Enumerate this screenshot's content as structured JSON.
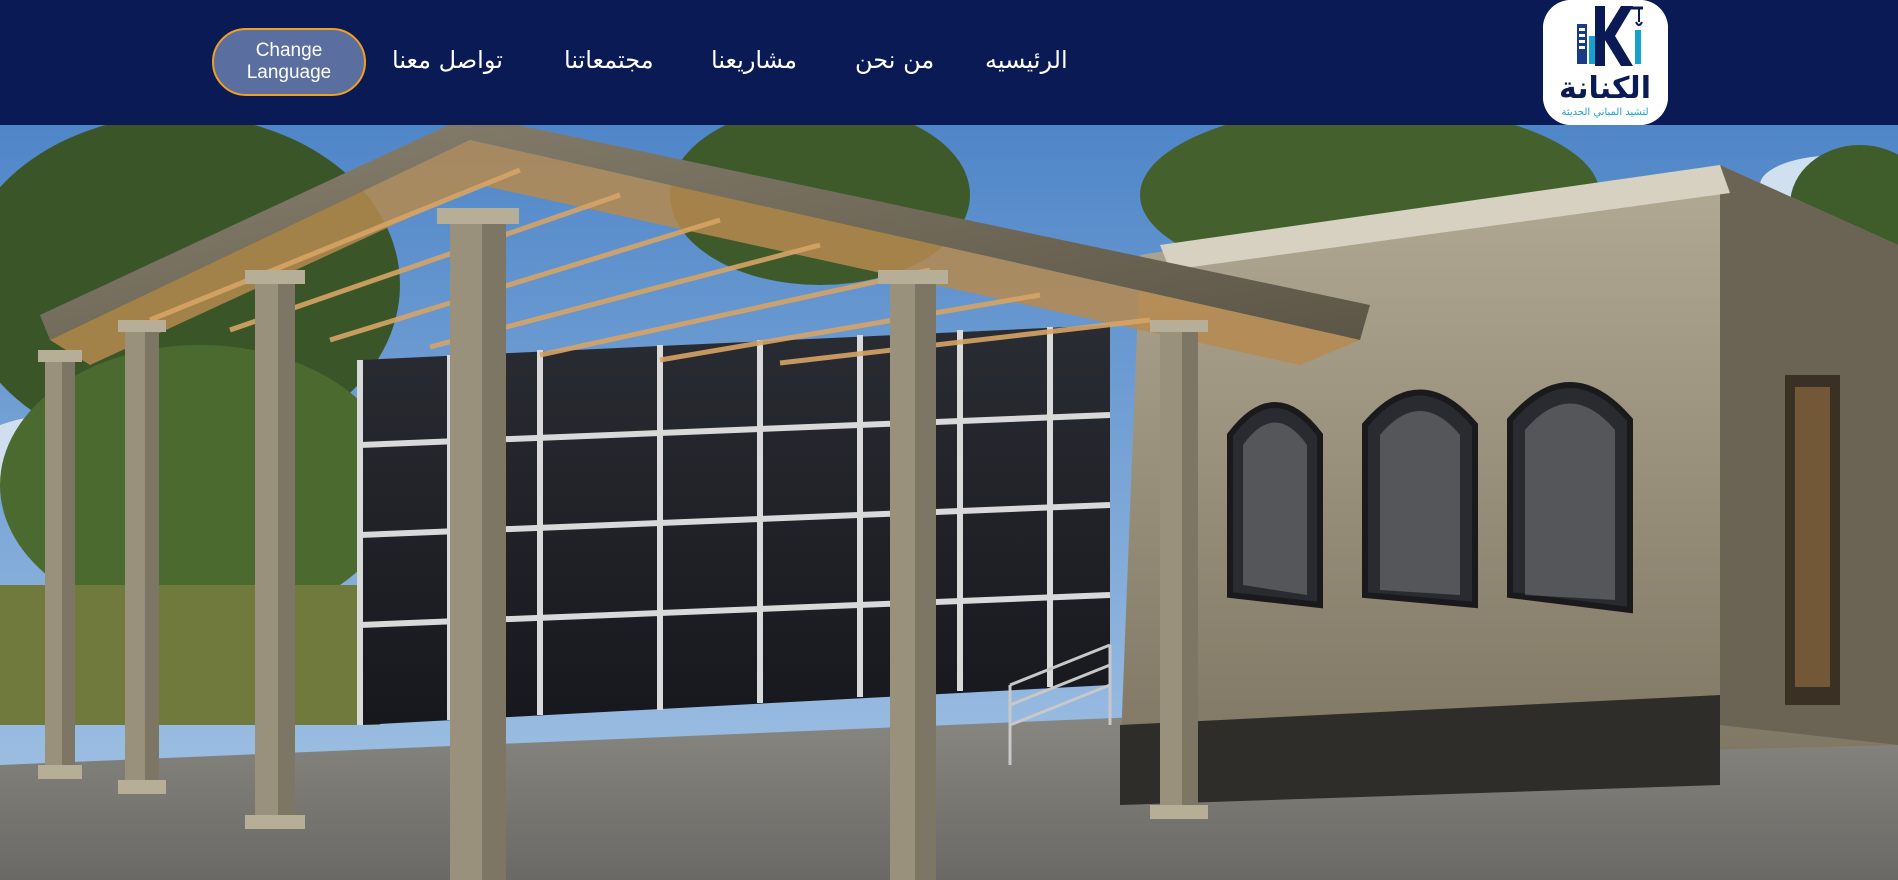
{
  "header": {
    "change_language_label": "Change\nLanguage",
    "nav": [
      {
        "label": "الرئيسيه"
      },
      {
        "label": "من نحن"
      },
      {
        "label": "مشاريعنا"
      },
      {
        "label": "مجتمعاتنا"
      },
      {
        "label": "تواصل معنا"
      }
    ],
    "logo": {
      "brand": "الكنانة",
      "tagline": "لتشيد المباني الحديثة",
      "letter": "K"
    }
  },
  "colors": {
    "header_bg": "#0a1a55",
    "button_bg": "#5a6ea0",
    "button_border": "#f0a020",
    "logo_blue": "#1a3a8a",
    "logo_cyan": "#1aa0d0"
  }
}
